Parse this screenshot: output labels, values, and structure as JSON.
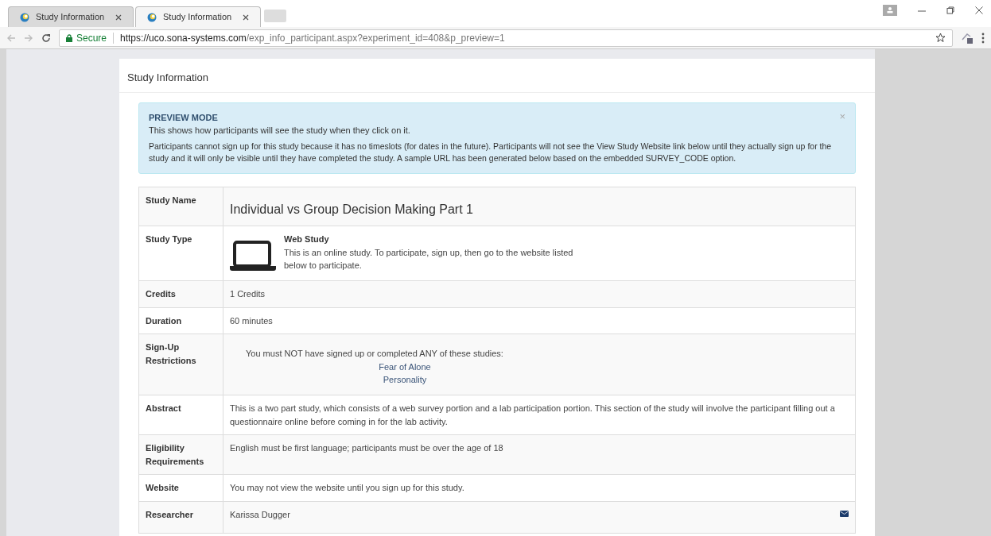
{
  "browser": {
    "tabs": [
      {
        "title": "Study Information",
        "selected": false
      },
      {
        "title": "Study Information",
        "selected": true
      }
    ],
    "secure_label": "Secure",
    "url_host": "https://uco.sona-systems.com",
    "url_path": "/exp_info_participant.aspx?experiment_id=408&p_preview=1"
  },
  "panel": {
    "title": "Study Information",
    "alert": {
      "heading": "PREVIEW MODE",
      "line": "This shows how participants will see the study when they click on it.",
      "body": "Participants cannot sign up for this study because it has no timeslots (for dates in the future). Participants will not see the View Study Website link below until they actually sign up for the study and it will only be visible until they have completed the study. A sample URL has been generated below based on the embedded SURVEY_CODE option.",
      "close": "×"
    },
    "rows": [
      {
        "kind": "title",
        "label": "Study Name",
        "value": "Individual vs Group Decision Making Part 1"
      },
      {
        "kind": "type",
        "label": "Study Type",
        "heading": "Web Study",
        "value": "This is an online study. To participate, sign up, then go to the website listed below to participate."
      },
      {
        "kind": "text",
        "label": "Credits",
        "value": "1 Credits"
      },
      {
        "kind": "text",
        "label": "Duration",
        "value": "60 minutes"
      },
      {
        "kind": "restrictions",
        "label": "Sign-Up Restrictions",
        "value": "You must NOT have signed up or completed ANY of these studies:",
        "studies": [
          "Fear of Alone",
          "Personality"
        ]
      },
      {
        "kind": "text",
        "label": "Abstract",
        "value": "This is a two part study, which consists of a web survey portion and a lab participation portion. This section of the study will involve the participant filling out a questionnaire online before coming in for the lab activity."
      },
      {
        "kind": "text",
        "label": "Eligibility Requirements",
        "value": "English must be first language; participants must be over the age of 18"
      },
      {
        "kind": "text",
        "label": "Website",
        "value": "You may not view the website until you sign up for this study."
      },
      {
        "kind": "researcher",
        "label": "Researcher",
        "value": "Karissa Dugger"
      }
    ]
  }
}
